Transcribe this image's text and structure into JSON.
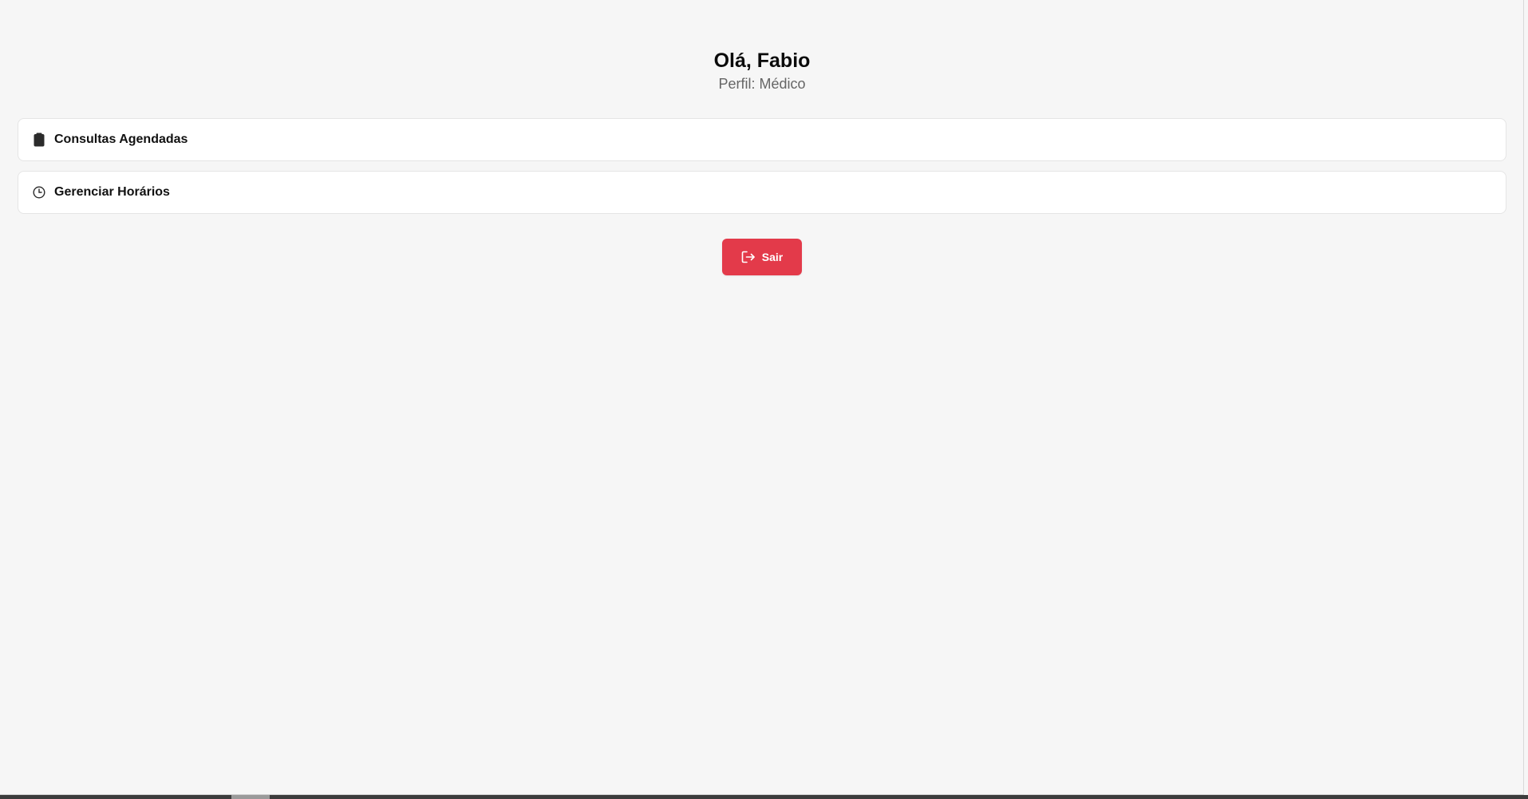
{
  "header": {
    "greeting": "Olá, Fabio",
    "profile": "Perfil: Médico"
  },
  "menu": {
    "items": [
      {
        "label": "Consultas Agendadas",
        "icon": "clipboard-icon"
      },
      {
        "label": "Gerenciar Horários",
        "icon": "clock-icon"
      }
    ]
  },
  "logout": {
    "label": "Sair",
    "icon": "sign-out-icon",
    "color": "#e33a4a"
  }
}
